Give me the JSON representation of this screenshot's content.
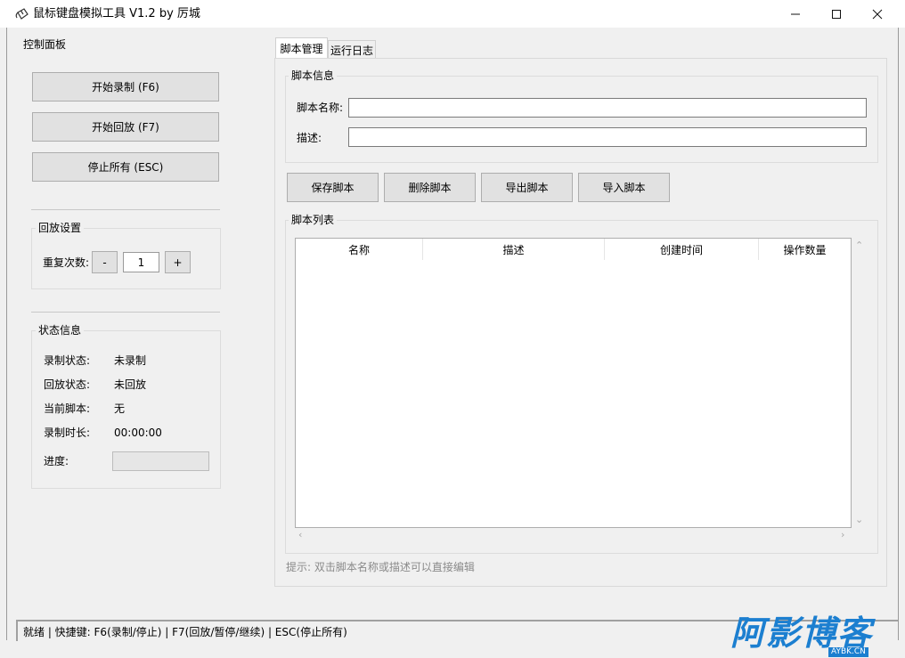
{
  "window": {
    "title": "鼠标键盘模拟工具 V1.2 by 厉城",
    "icon": "mouse-icon",
    "min_glyph": "—",
    "max_glyph": "☐",
    "close_glyph": "✕"
  },
  "control_panel": {
    "title": "控制面板",
    "start_record": "开始录制 (F6)",
    "start_playback": "开始回放 (F7)",
    "stop_all": "停止所有 (ESC)"
  },
  "playback_settings": {
    "title": "回放设置",
    "repeat_label": "重复次数:",
    "minus": "-",
    "value": "1",
    "plus": "+"
  },
  "status_info": {
    "title": "状态信息",
    "rows": [
      {
        "label": "录制状态:",
        "value": "未录制"
      },
      {
        "label": "回放状态:",
        "value": "未回放"
      },
      {
        "label": "当前脚本:",
        "value": "无"
      },
      {
        "label": "录制时长:",
        "value": "00:00:00"
      }
    ],
    "progress_label": "进度:",
    "progress_value": 0
  },
  "tabs": [
    {
      "label": "脚本管理",
      "selected": true
    },
    {
      "label": "运行日志",
      "selected": false
    }
  ],
  "script_info": {
    "title": "脚本信息",
    "name_label": "脚本名称:",
    "name_value": "",
    "desc_label": "描述:",
    "desc_value": ""
  },
  "actions": {
    "save": "保存脚本",
    "delete": "删除脚本",
    "export": "导出脚本",
    "import": "导入脚本"
  },
  "script_list": {
    "title": "脚本列表",
    "columns": [
      "名称",
      "描述",
      "创建时间",
      "操作数量"
    ],
    "rows": []
  },
  "hint": "提示: 双击脚本名称或描述可以直接编辑",
  "statusbar": "就绪 | 快捷键: F6(录制/停止) | F7(回放/暂停/继续) | ESC(停止所有)",
  "watermark": {
    "text": "阿影博客",
    "sub": "AYBK.CN"
  },
  "colors": {
    "accent": "#1c7fd0",
    "hint": "#8a8a8a"
  }
}
